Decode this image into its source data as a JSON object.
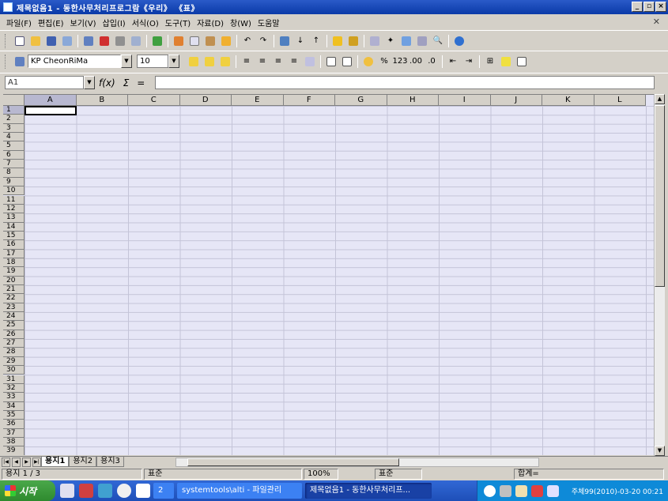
{
  "window": {
    "title": "제목없음1 - 동한사무처리프로그람《우리》 《표》"
  },
  "menu": [
    "파일(F)",
    "편집(E)",
    "보기(V)",
    "삽입(I)",
    "서식(O)",
    "도구(T)",
    "자료(D)",
    "창(W)",
    "도움말"
  ],
  "format_toolbar": {
    "font_name": "KP CheonRiMa",
    "font_size": "10"
  },
  "formula_bar": {
    "cell_ref": "A1",
    "fx": "f(x)",
    "sigma": "Σ",
    "equals": "="
  },
  "columns": [
    "A",
    "B",
    "C",
    "D",
    "E",
    "F",
    "G",
    "H",
    "I",
    "J",
    "K",
    "L"
  ],
  "rows": [
    "1",
    "2",
    "3",
    "4",
    "5",
    "6",
    "7",
    "8",
    "9",
    "10",
    "11",
    "12",
    "13",
    "14",
    "15",
    "16",
    "17",
    "18",
    "19",
    "20",
    "21",
    "22",
    "23",
    "24",
    "25",
    "26",
    "27",
    "28",
    "29",
    "30",
    "31",
    "32",
    "33",
    "34",
    "35",
    "36",
    "37",
    "38",
    "39"
  ],
  "sheet_tabs": [
    "용지1",
    "용지2",
    "용지3"
  ],
  "status": {
    "sheet": "용지 1 / 3",
    "style": "표준",
    "zoom": "100%",
    "mode": "표준",
    "sum": "합계="
  },
  "taskbar": {
    "start": "시작",
    "desktop_count": "2",
    "tasks": [
      "systemtools\\alti - 파일관리",
      "제목없음1 - 동한사무처리프..."
    ],
    "clock": "주체99(2010)-03-20  00:21"
  },
  "colors": {
    "titlebar": "#0a3aa8",
    "grid_bg": "#e6e6f6",
    "taskbar": "#1e4fb8",
    "start": "#2e8a2e"
  }
}
